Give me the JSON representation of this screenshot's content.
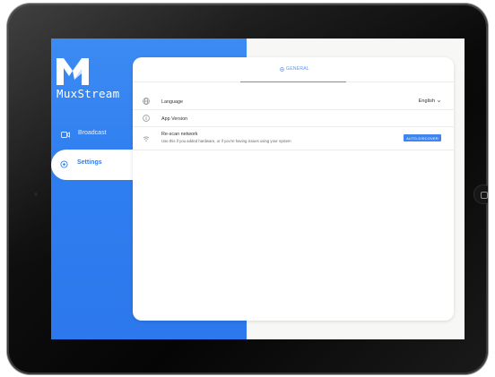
{
  "app": {
    "name": "MuxStream",
    "logo_icon": "muxstream-logo-icon"
  },
  "sidebar": {
    "items": [
      {
        "label": "Broadcast",
        "icon": "video-camera-icon",
        "active": false
      },
      {
        "label": "Settings",
        "icon": "settings-icon",
        "active": true
      }
    ]
  },
  "tabs": [
    {
      "label": "GENERAL",
      "icon": "settings-icon",
      "active": true
    }
  ],
  "settings": {
    "language": {
      "label": "Language",
      "value": "English",
      "icon": "globe-icon"
    },
    "version": {
      "label": "App Version",
      "icon": "info-icon"
    },
    "rescan": {
      "label": "Re-scan network",
      "description": "Use this if you added hardware, or if you're having issues using your system",
      "button_label": "AUTO-DISCOVER",
      "icon": "wifi-icon"
    }
  },
  "colors": {
    "accent": "#2f7ef0",
    "panel_blue": "#3c8bf3",
    "screen_background": "#f7f7f5",
    "bezel": "#0a0a0a"
  }
}
